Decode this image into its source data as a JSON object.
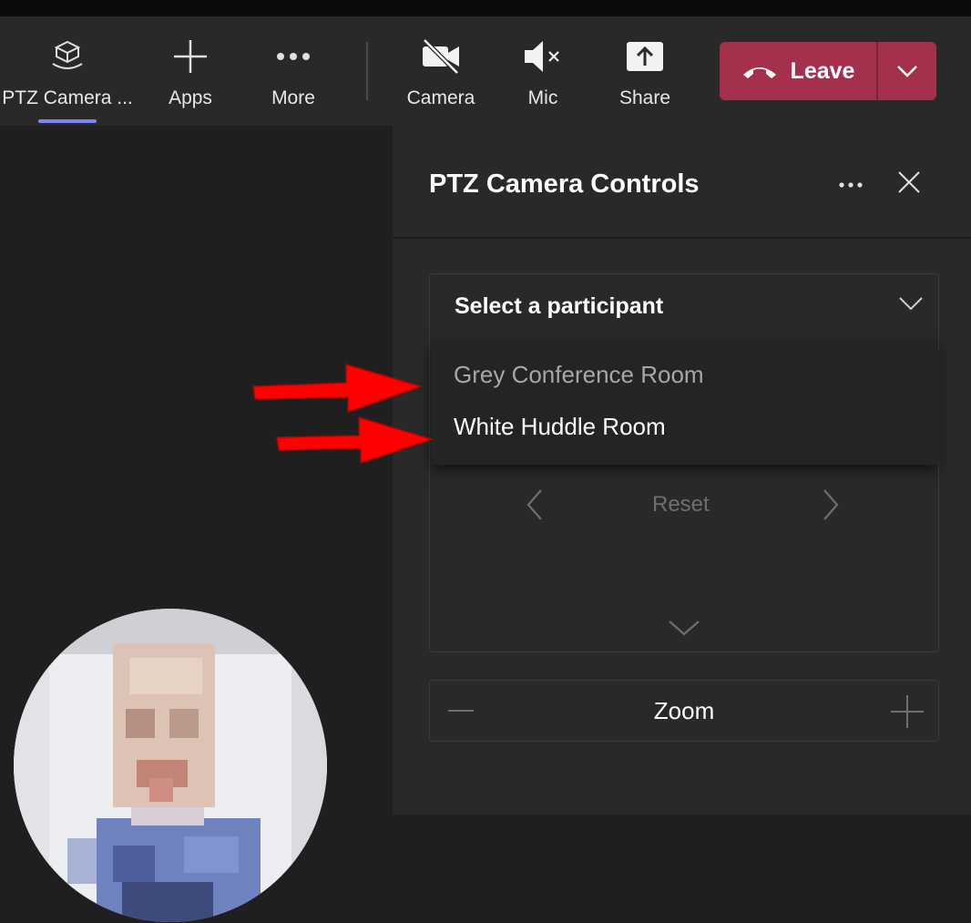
{
  "toolbar": {
    "items": [
      {
        "label": "PTZ Camera ...",
        "icon": "ptz-camera-icon",
        "active": true
      },
      {
        "label": "Apps",
        "icon": "plus-icon"
      },
      {
        "label": "More",
        "icon": "ellipsis-icon"
      },
      {
        "label": "Camera",
        "icon": "camera-off-icon"
      },
      {
        "label": "Mic",
        "icon": "mic-muted-icon"
      },
      {
        "label": "Share",
        "icon": "share-icon"
      }
    ],
    "leave": {
      "label": "Leave",
      "icon": "hang-up-icon",
      "dropdown_icon": "chevron-down-icon"
    },
    "accent_color": "#7f85f5",
    "leave_color": "#a4304b"
  },
  "panel": {
    "title": "PTZ Camera Controls",
    "more_icon": "ellipsis-icon",
    "close_icon": "close-icon",
    "participant_select": {
      "placeholder": "Select a participant",
      "options": [
        "Grey Conference Room",
        "White Huddle Room"
      ]
    },
    "controls": {
      "pan_left_icon": "chevron-left-icon",
      "reset_label": "Reset",
      "pan_right_icon": "chevron-right-icon",
      "tilt_down_icon": "chevron-down-icon"
    },
    "zoom": {
      "label": "Zoom",
      "out_icon": "minus-icon",
      "in_icon": "plus-icon"
    }
  },
  "annotations": {
    "arrow_color": "#ff0000",
    "arrow_icon": "red-arrow-icon"
  }
}
